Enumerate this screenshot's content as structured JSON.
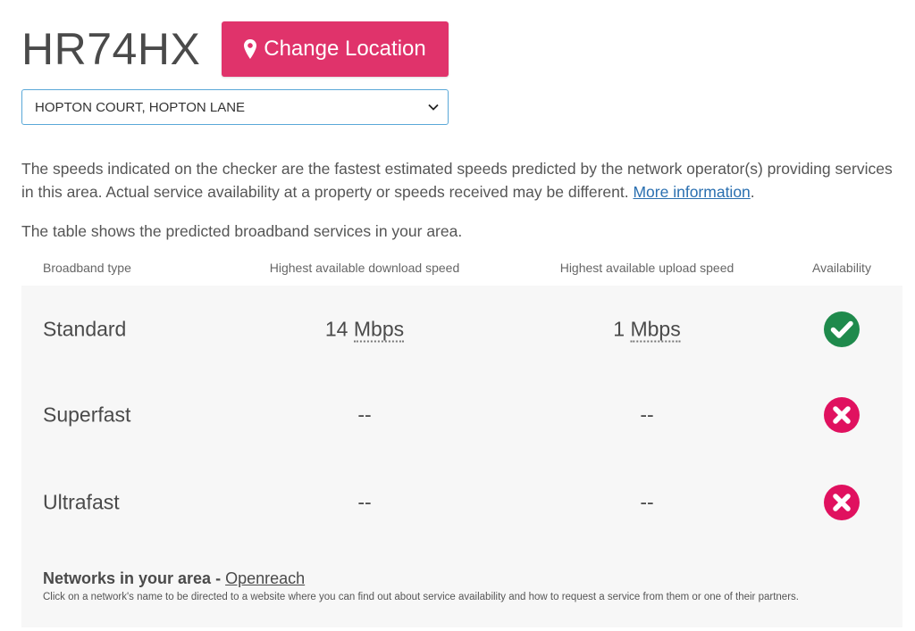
{
  "postcode": "HR74HX",
  "change_location": {
    "label": "Change Location",
    "icon": "map-marker-icon",
    "color": "#e0336b"
  },
  "address_select": {
    "selected": "HOPTON COURT, HOPTON LANE"
  },
  "info": {
    "text": "The speeds indicated on the checker are the fastest estimated speeds predicted by the network operator(s) providing services in this area. Actual service availability at a property or speeds received may be different. ",
    "link_text": "More information",
    "trailing": "."
  },
  "table_intro": "The table shows the predicted broadband services in your area.",
  "table": {
    "headers": {
      "type": "Broadband type",
      "download": "Highest available download speed",
      "upload": "Highest available upload speed",
      "availability": "Availability"
    },
    "rows": [
      {
        "type": "Standard",
        "download_value": "14",
        "download_unit": "Mbps",
        "upload_value": "1",
        "upload_unit": "Mbps",
        "available": true,
        "status_icon": "check-circle-icon",
        "status_color": "#1f8a4c"
      },
      {
        "type": "Superfast",
        "download_value": "--",
        "download_unit": "",
        "upload_value": "--",
        "upload_unit": "",
        "available": false,
        "status_icon": "cross-circle-icon",
        "status_color": "#e0115f"
      },
      {
        "type": "Ultrafast",
        "download_value": "--",
        "download_unit": "",
        "upload_value": "--",
        "upload_unit": "",
        "available": false,
        "status_icon": "cross-circle-icon",
        "status_color": "#e0115f"
      }
    ]
  },
  "networks": {
    "label": "Networks in your area - ",
    "link": "Openreach",
    "note": "Click on a network's name to be directed to a website where you can find out about service availability and how to request a service from them or one of their partners."
  }
}
